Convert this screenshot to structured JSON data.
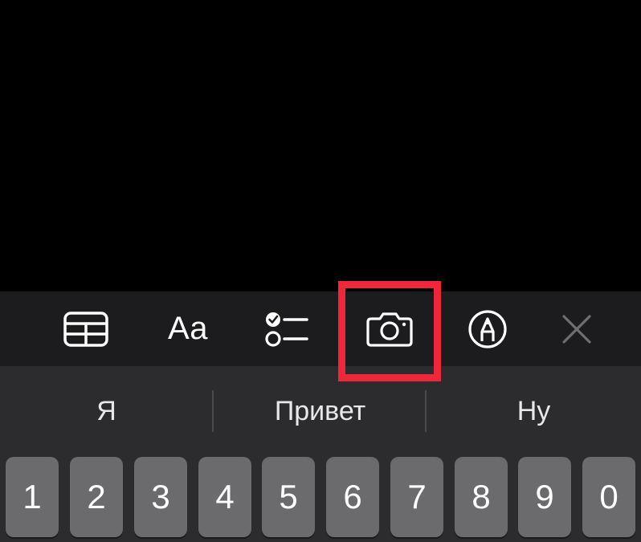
{
  "toolbar": {
    "items": [
      {
        "name": "table",
        "icon": "table-icon"
      },
      {
        "name": "format",
        "label": "Aa"
      },
      {
        "name": "checklist",
        "icon": "checklist-icon"
      },
      {
        "name": "camera",
        "icon": "camera-icon"
      },
      {
        "name": "markup",
        "icon": "markup-pen-icon"
      },
      {
        "name": "close",
        "icon": "close-icon"
      }
    ],
    "highlighted_item": "camera",
    "highlight_color": "#f0273a"
  },
  "keyboard": {
    "suggestions": [
      "Я",
      "Привет",
      "Ну"
    ],
    "number_keys": [
      "1",
      "2",
      "3",
      "4",
      "5",
      "6",
      "7",
      "8",
      "9",
      "0"
    ]
  },
  "colors": {
    "background": "#000000",
    "toolbar": "#1c1c1e",
    "keyboard": "#2c2c2e",
    "key": "#6b6b6e"
  }
}
